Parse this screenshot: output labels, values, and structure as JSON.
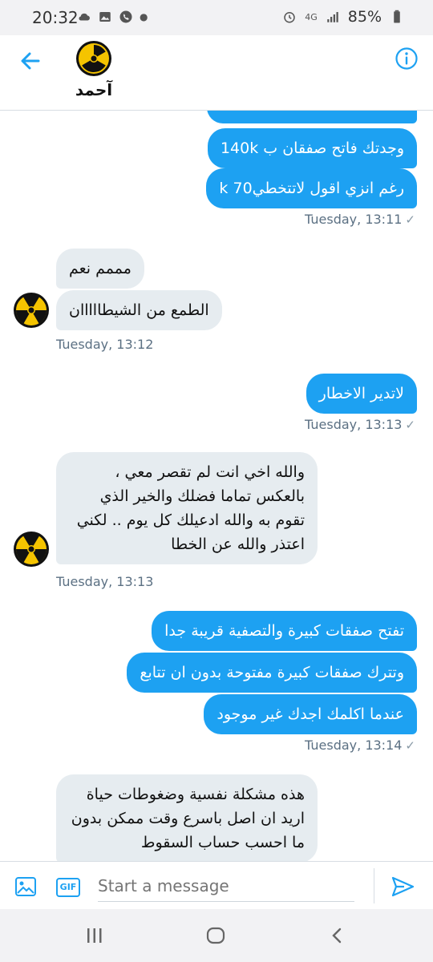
{
  "status": {
    "time": "20:32",
    "network": "4G",
    "battery": "85%",
    "icons": [
      "cloud-icon",
      "image-icon",
      "phone-icon",
      "alarm-icon",
      "signal-icon",
      "battery-icon"
    ]
  },
  "header": {
    "contact_name": "آحمد",
    "back_icon": "arrow-left-icon",
    "info_icon": "info-icon"
  },
  "messages": [
    {
      "dir": "out",
      "text": "وجدتك فاتح صفقان ب 140k"
    },
    {
      "dir": "out",
      "text": "رغم انزي اقول لاتتخطي70 k"
    },
    {
      "dir": "stamp-out",
      "text": "Tuesday, 13:11"
    },
    {
      "dir": "in",
      "text": "مممم نعم"
    },
    {
      "dir": "in",
      "text": "الطمع من الشيطااااان"
    },
    {
      "dir": "stamp-in",
      "text": "Tuesday, 13:12"
    },
    {
      "dir": "out",
      "text": "لاتدير الاخطار"
    },
    {
      "dir": "stamp-out",
      "text": "Tuesday, 13:13"
    },
    {
      "dir": "in",
      "text": "والله اخي انت لم تقصر معي ، بالعكس تماما فضلك والخير الذي تقوم به والله ادعيلك كل يوم .. لكني اعتذر والله عن الخطا"
    },
    {
      "dir": "stamp-in",
      "text": "Tuesday, 13:13"
    },
    {
      "dir": "out",
      "text": "تفتح صفقات كبيرة والتصفية قريبة جدا"
    },
    {
      "dir": "out",
      "text": "وتترك صفقات كبيرة مفتوحة بدون ان تتابع"
    },
    {
      "dir": "out",
      "text": "عندما اكلمك اجدك غير موجود"
    },
    {
      "dir": "stamp-out",
      "text": "Tuesday, 13:14"
    },
    {
      "dir": "in",
      "text": "هذه مشكلة نفسية وضغوطات حياة اريد ان اصل باسرع وقت ممكن بدون ما احسب حساب السقوط"
    }
  ],
  "composer": {
    "placeholder": "Start a message",
    "gif_label": "GIF"
  },
  "colors": {
    "accent": "#1da1f2",
    "incoming_bubble": "#e6ecf0",
    "timestamp": "#5b7083"
  }
}
